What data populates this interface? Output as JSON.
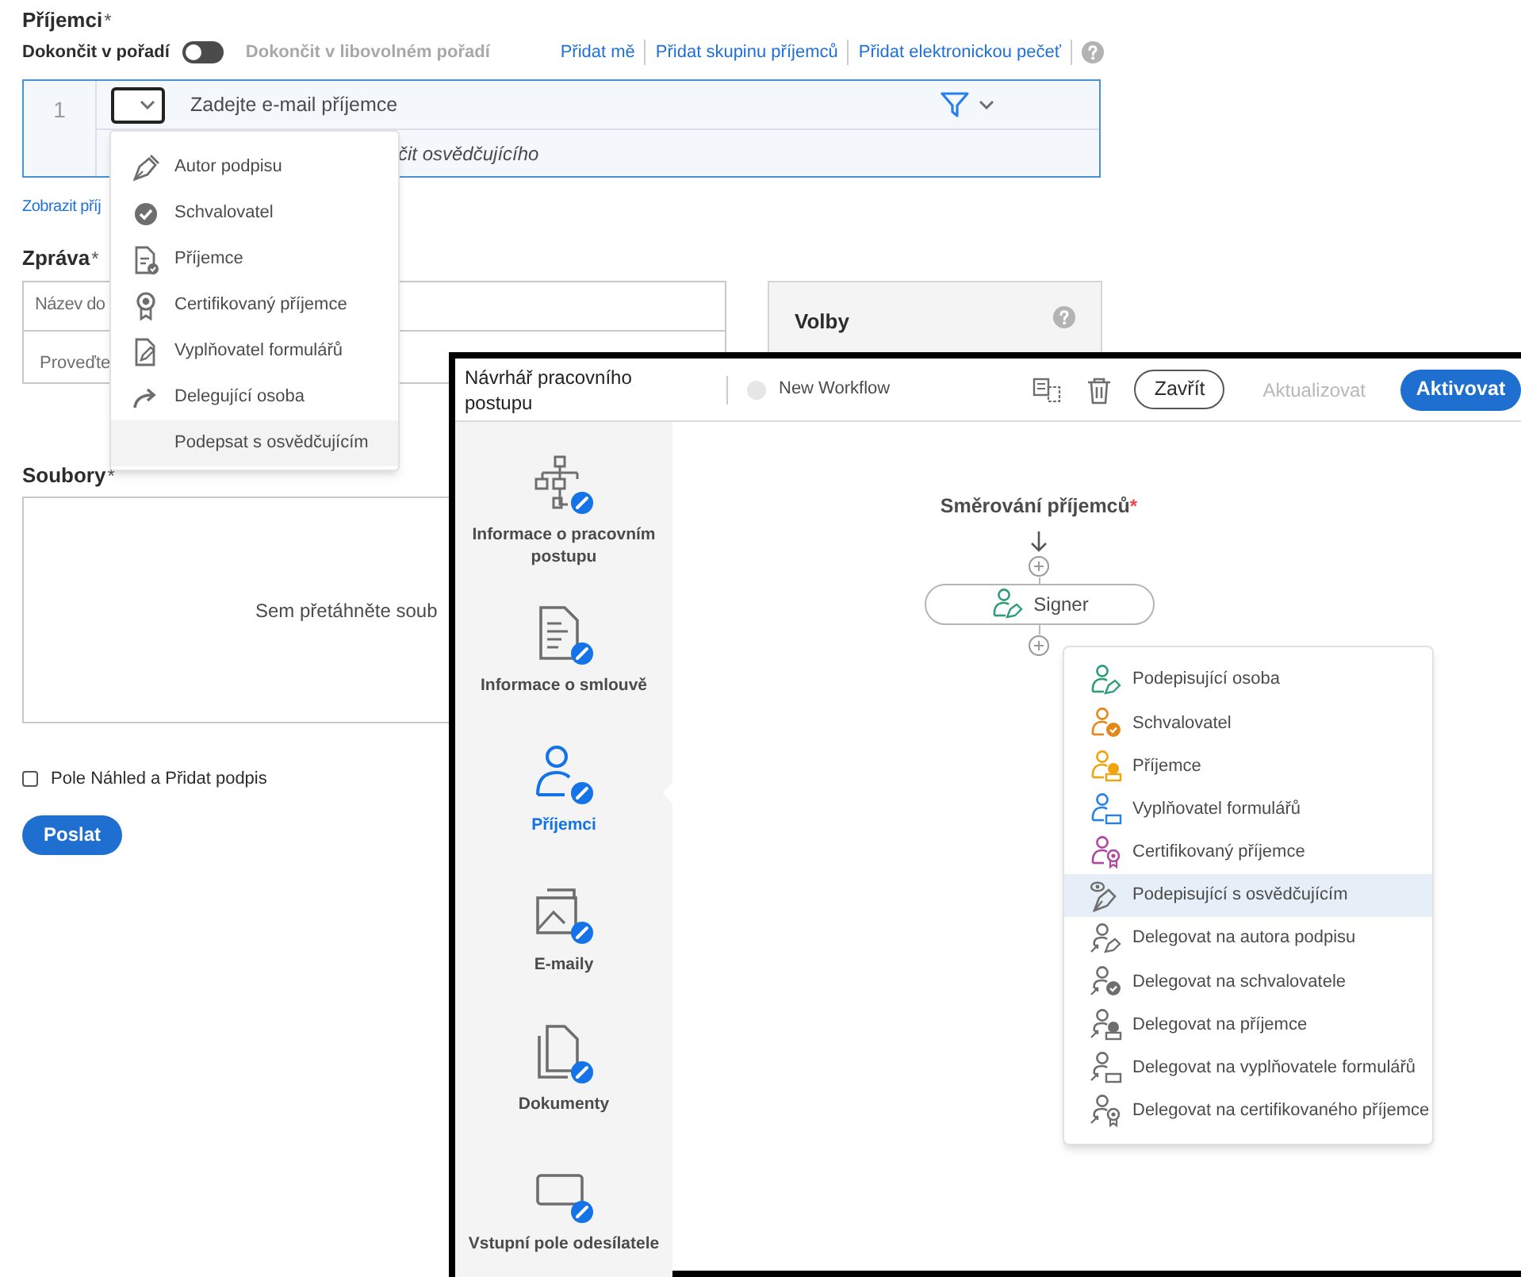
{
  "recipients": {
    "title": "Příjemci",
    "mark": "*",
    "order": {
      "label": "Dokončit v pořadí",
      "on": false,
      "alt_label": "Dokončit v libovolném pořadí"
    },
    "links": [
      "Přidat mě",
      "Přidat skupinu příjemců",
      "Přidat elektronickou pečeť"
    ],
    "rows": [
      {
        "number": "1",
        "placeholder": "Zadejte e-mail příjemce",
        "note": "čit osvědčujícího"
      }
    ],
    "show_link": "Zobrazit příj"
  },
  "role_dropdown": {
    "items": [
      {
        "label": "Autor podpisu",
        "kind": "pen",
        "selected": false
      },
      {
        "label": "Schvalovatel",
        "kind": "check",
        "selected": false
      },
      {
        "label": "Příjemce",
        "kind": "doc",
        "selected": false
      },
      {
        "label": "Certifikovaný příjemce",
        "kind": "seal",
        "selected": false
      },
      {
        "label": "Vyplňovatel formulářů",
        "kind": "form",
        "selected": false
      },
      {
        "label": "Delegující osoba",
        "kind": "arrow",
        "selected": false
      },
      {
        "label": "Podepsat s osvědčujícím",
        "kind": "none",
        "selected": true
      }
    ]
  },
  "message": {
    "title": "Zpráva",
    "mark": "*",
    "name_placeholder": "Název do",
    "body_placeholder": "Proveďte"
  },
  "options": {
    "title": "Volby"
  },
  "files": {
    "title": "Soubory",
    "mark": "*",
    "drop_text": "Sem přetáhněte soub"
  },
  "preview_checkbox": {
    "label": "Pole Náhled a Přidat podpis",
    "checked": false
  },
  "send_button": "Poslat",
  "designer": {
    "title": "Návrhář pracovního postupu",
    "workflow_name": "New Workflow",
    "close_button": "Zavřít",
    "update_button": {
      "label": "Aktualizovat",
      "disabled": true
    },
    "activate_button": "Aktivovat",
    "sidebar": [
      {
        "label": "Informace o pracovním postupu",
        "kind": "hierarchy",
        "selected": false
      },
      {
        "label": "Informace o smlouvě",
        "kind": "document",
        "selected": false
      },
      {
        "label": "Příjemci",
        "kind": "person",
        "selected": true
      },
      {
        "label": "E-maily",
        "kind": "image",
        "selected": false
      },
      {
        "label": "Dokumenty",
        "kind": "pages",
        "selected": false
      },
      {
        "label": "Vstupní pole odesílatele",
        "kind": "field",
        "selected": false
      }
    ],
    "routing": {
      "title": "Směrování příjemců",
      "mark": "*",
      "node": {
        "label": "Signer",
        "kind": "signer",
        "color": "#2d9d78"
      }
    },
    "role_menu": [
      {
        "label": "Podepisující osoba",
        "kind": "signer",
        "delegate": false,
        "color": "#2d9d78",
        "selected": false
      },
      {
        "label": "Schvalovatel",
        "kind": "approver",
        "delegate": false,
        "color": "#e68619",
        "selected": false
      },
      {
        "label": "Příjemce",
        "kind": "acceptor",
        "delegate": false,
        "color": "#f0a30a",
        "selected": false
      },
      {
        "label": "Vyplňovatel formulářů",
        "kind": "filler",
        "delegate": false,
        "color": "#2680eb",
        "selected": false
      },
      {
        "label": "Certifikovaný příjemce",
        "kind": "certified",
        "delegate": false,
        "color": "#b2469e",
        "selected": false
      },
      {
        "label": "Podepisující s osvědčujícím",
        "kind": "witness",
        "delegate": false,
        "color": "#6e6e6e",
        "selected": true
      },
      {
        "label": "Delegovat na autora podpisu",
        "kind": "signer",
        "delegate": true,
        "color": "#6e6e6e",
        "selected": false
      },
      {
        "label": "Delegovat na schvalovatele",
        "kind": "approver",
        "delegate": true,
        "color": "#6e6e6e",
        "selected": false
      },
      {
        "label": "Delegovat na příjemce",
        "kind": "acceptor",
        "delegate": true,
        "color": "#6e6e6e",
        "selected": false
      },
      {
        "label": "Delegovat na vyplňovatele formulářů",
        "kind": "filler",
        "delegate": true,
        "color": "#6e6e6e",
        "selected": false
      },
      {
        "label": "Delegovat na certifikovaného příjemce",
        "kind": "certified",
        "delegate": true,
        "color": "#6e6e6e",
        "selected": false
      }
    ]
  }
}
